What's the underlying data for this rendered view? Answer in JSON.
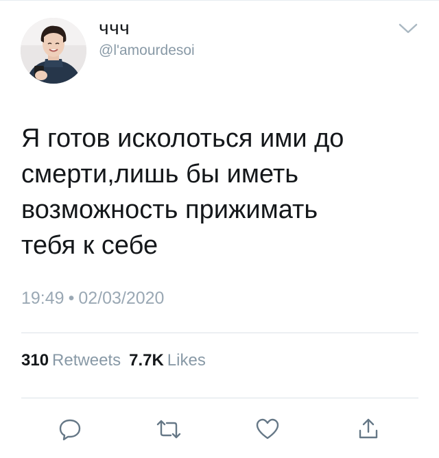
{
  "tweet": {
    "display_name": "ччч",
    "handle": "@l'amourdesoi",
    "text": "Я готов исколоться ими до\nсмерти,лишь бы иметь\nвозможность прижимать\nтебя к себе",
    "time": "19:49",
    "separator": "•",
    "date": "02/03/2020",
    "stats": {
      "retweets_count": "310",
      "retweets_label": "Retweets",
      "likes_count": "7.7K",
      "likes_label": "Likes"
    },
    "actions": {
      "reply_icon": "reply-icon",
      "retweet_icon": "retweet-icon",
      "like_icon": "heart-icon",
      "share_icon": "share-icon"
    },
    "colors": {
      "text": "#14171a",
      "secondary": "#8899a6",
      "divider": "#dbe2e7",
      "icon": "#657786"
    }
  }
}
